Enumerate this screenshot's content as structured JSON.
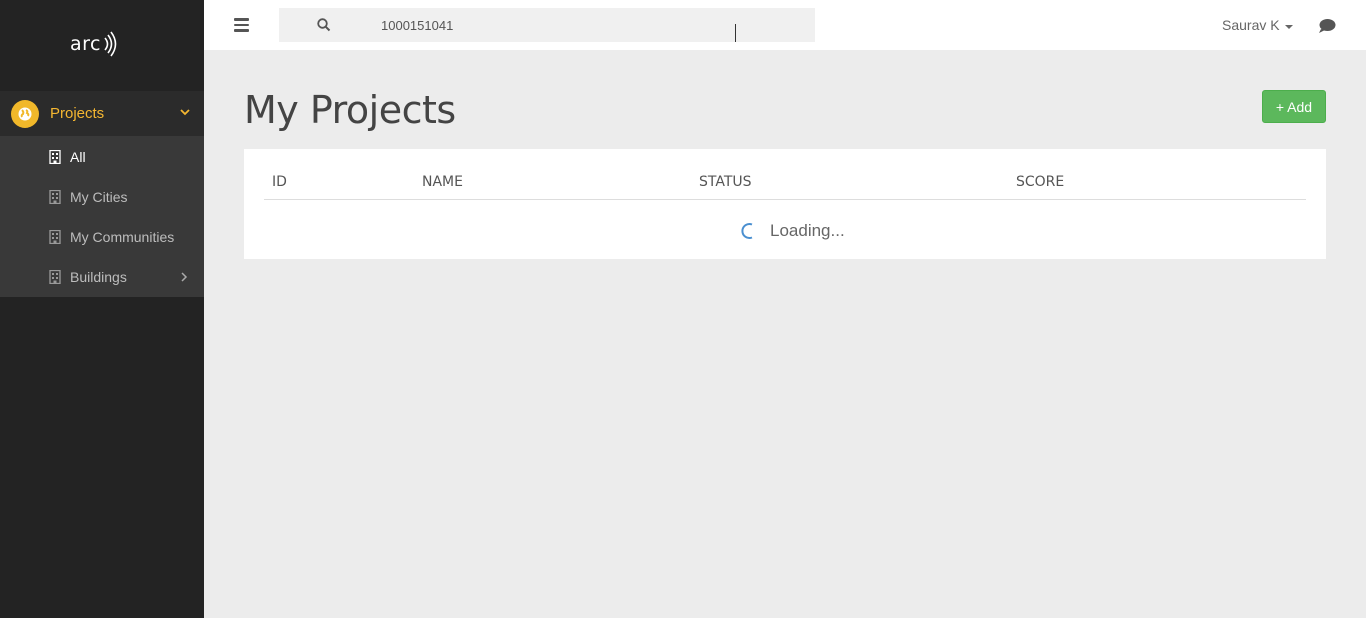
{
  "app": {
    "logo_text": "arc"
  },
  "sidebar": {
    "projects_label": "Projects",
    "items": [
      {
        "label": "All",
        "active": true
      },
      {
        "label": "My Cities",
        "active": false
      },
      {
        "label": "My Communities",
        "active": false
      },
      {
        "label": "Buildings",
        "active": false,
        "has_submenu": true
      }
    ]
  },
  "topbar": {
    "search_value": "1000151041",
    "user_name": "Saurav K"
  },
  "main": {
    "title": "My Projects",
    "add_label": "+ Add",
    "table": {
      "columns": [
        "ID",
        "NAME",
        "STATUS",
        "SCORE"
      ],
      "loading_text": "Loading..."
    }
  },
  "colors": {
    "accent": "#f5b731",
    "success": "#5cb85c",
    "sidebar_bg": "#232323"
  }
}
